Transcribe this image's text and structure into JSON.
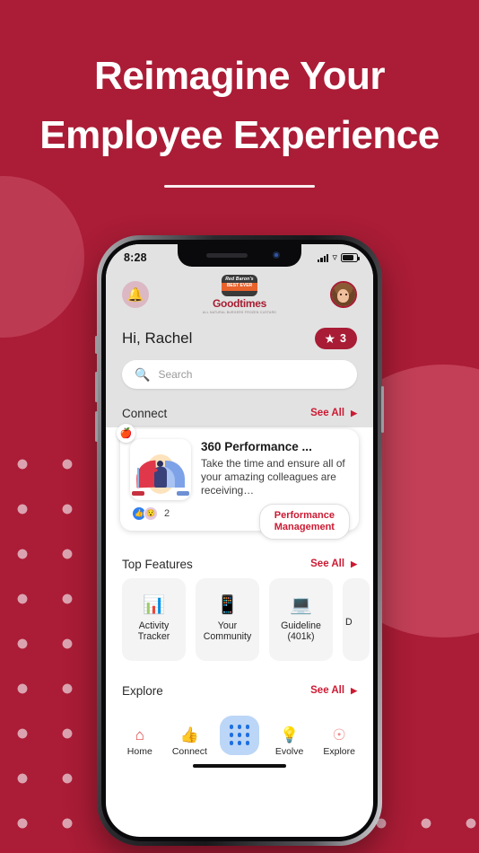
{
  "hero": {
    "line1": "Reimagine Your",
    "line2": "Employee Experience"
  },
  "colors": {
    "background": "#ab1c36",
    "circle_light": "#c23f57",
    "dots": "#dba3b0",
    "accent_red": "#cc1a33",
    "brand_red": "#a81c35",
    "nav_active_bg": "#bcd6f7"
  },
  "phone": {
    "status_bar": {
      "time": "8:28",
      "signal_icon": "cellular-signal-icon",
      "wifi_icon": "wifi-icon",
      "battery_icon": "battery-icon"
    },
    "header": {
      "notification_icon": "bell-icon",
      "brand_name": "Goodtimes",
      "brand_mark_top": "Red Baron's",
      "brand_mark_mid": "BEST EVER",
      "brand_tagline": "ALL NATURAL BURGERS\nFROZEN CUSTARD",
      "avatar_icon": "user-avatar"
    },
    "greeting": "Hi, Rachel",
    "points_badge": {
      "icon": "star-icon",
      "count": "3"
    },
    "search": {
      "icon": "search-icon",
      "placeholder": "Search",
      "value": ""
    },
    "sections": {
      "connect": {
        "title": "Connect",
        "see_all": "See All",
        "see_all_arrow": "chevron-right-icon"
      },
      "top_features": {
        "title": "Top Features",
        "see_all": "See All",
        "see_all_arrow": "chevron-right-icon"
      },
      "explore": {
        "title": "Explore",
        "see_all": "See All",
        "see_all_arrow": "chevron-right-icon"
      }
    },
    "connect_card": {
      "badge_icon": "apple-icon",
      "badge_emoji": "🍎",
      "thumbnail_icon": "performance-gauge-illustration",
      "title": "360 Performance ...",
      "description": "Take the time and ensure all of your amazing colleagues are receiving…",
      "reactions": {
        "like_icon": "thumbs-up-reaction-icon",
        "wow_icon": "wow-reaction-icon",
        "count": "2"
      },
      "tag_line1": "Performance",
      "tag_line2": "Management"
    },
    "features": [
      {
        "icon": "activity-tracker-icon",
        "glyph": "📊",
        "label_line1": "Activity",
        "label_line2": "Tracker"
      },
      {
        "icon": "your-community-icon",
        "glyph": "📱",
        "label_line1": "Your",
        "label_line2": "Community"
      },
      {
        "icon": "guideline-401k-icon",
        "glyph": "💻",
        "label_line1": "Guideline",
        "label_line2": "(401k)"
      },
      {
        "icon": "partial-feature-icon",
        "glyph": "",
        "label_line1": "D",
        "label_line2": ""
      }
    ],
    "bottom_nav": [
      {
        "icon": "home-icon",
        "glyph": "⌂",
        "label": "Home"
      },
      {
        "icon": "thumbs-up-icon",
        "glyph": "👍",
        "label": "Connect"
      },
      {
        "icon": "apps-grid-icon",
        "glyph": "",
        "label": ""
      },
      {
        "icon": "lightbulb-icon",
        "glyph": "💡",
        "label": "Evolve"
      },
      {
        "icon": "compass-icon",
        "glyph": "☉",
        "label": "Explore"
      }
    ]
  }
}
